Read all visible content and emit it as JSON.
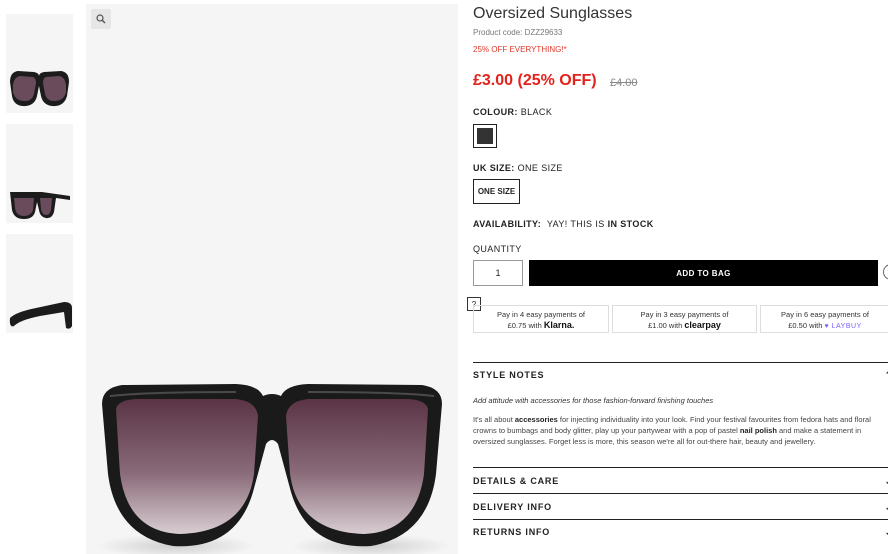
{
  "product": {
    "title": "Oversized Sunglasses",
    "code": "Product code: DZZ29633",
    "promo": "25% OFF EVERYTHING!*",
    "price": "£3.00 (25% OFF)",
    "old_price": "£4.00"
  },
  "colour": {
    "label": "COLOUR:",
    "value": "BLACK",
    "swatch_color": "#333333"
  },
  "size": {
    "label": "UK SIZE:",
    "value": "ONE SIZE",
    "option": "ONE SIZE"
  },
  "availability": {
    "label": "AVAILABILITY:",
    "value_prefix": "YAY! THIS IS",
    "value_strong": "IN STOCK"
  },
  "quantity": {
    "label": "QUANTITY",
    "value": "1"
  },
  "add_to_bag": "ADD TO BAG",
  "help": "?",
  "payments": [
    {
      "line1": "Pay in 4 easy payments of",
      "amount": "£0.75 with",
      "brand": "Klarna."
    },
    {
      "line1": "Pay in 3 easy payments of",
      "amount": "£1.00 with",
      "brand": "clearpay"
    },
    {
      "line1": "Pay in 6 easy payments of",
      "amount": "£0.50 with",
      "brand": "LAYBUY"
    }
  ],
  "style_notes": {
    "heading": "STYLE NOTES",
    "tagline": "Add attitude with accessories for those fashion-forward finishing touches",
    "p1": "It's all about ",
    "b1": "accessories",
    "p2": " for injecting individuality into your look. Find your festival favourites from fedora hats and floral crowns to bumbags and body glitter, play up your partywear with a pop of pastel ",
    "b2": "nail polish",
    "p3": " and make a statement in oversized sunglasses. Forget less is more, this season we're all for out-there hair, beauty and jewellery."
  },
  "sections": [
    "DETAILS & CARE",
    "DELIVERY INFO",
    "RETURNS INFO"
  ],
  "icons": {
    "zoom": "magnifier-icon",
    "wishlist": "heart-icon",
    "chevron": "chevron-icon"
  }
}
